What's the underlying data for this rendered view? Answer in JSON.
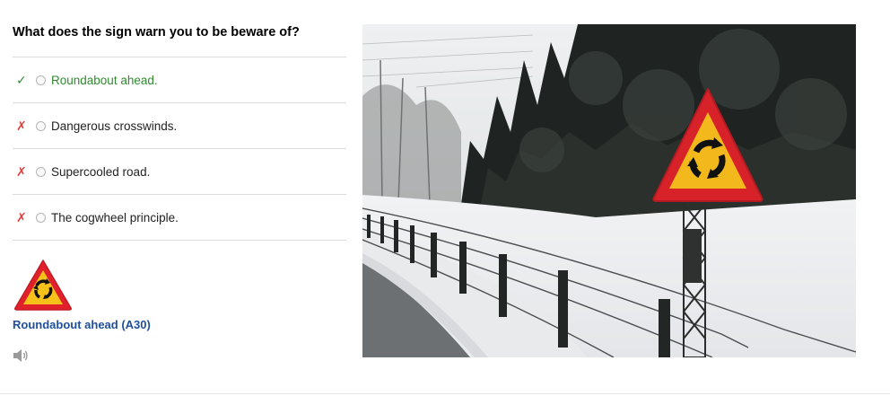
{
  "question": "What does the sign warn you to be beware of?",
  "options": [
    {
      "label": "Roundabout ahead.",
      "status": "correct"
    },
    {
      "label": "Dangerous crosswinds.",
      "status": "wrong"
    },
    {
      "label": "Supercooled road.",
      "status": "wrong"
    },
    {
      "label": "The cogwheel principle.",
      "status": "wrong"
    }
  ],
  "marks": {
    "correct": "✓",
    "wrong": "✗"
  },
  "sign": {
    "name": "Roundabout ahead (A30)",
    "icon": "roundabout-warning-sign-icon"
  },
  "audio": {
    "icon": "speaker-icon"
  },
  "colors": {
    "correct": "#2f8a2f",
    "wrong": "#e04040",
    "link": "#1d4f9c",
    "sign_border": "#e0202a",
    "sign_fill": "#f6c21a"
  }
}
